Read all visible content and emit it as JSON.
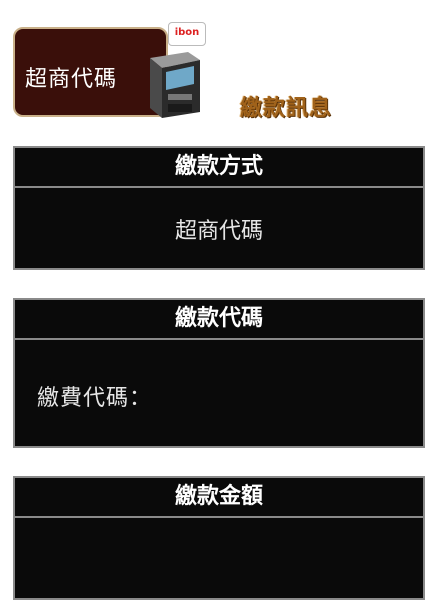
{
  "banner": {
    "label": "超商代碼",
    "badge": "ibon"
  },
  "info_title": "繳款訊息",
  "sections": [
    {
      "header": "繳款方式",
      "content": "超商代碼"
    },
    {
      "header": "繳款代碼",
      "content": "繳費代碼："
    },
    {
      "header": "繳款金額",
      "content": ""
    }
  ],
  "colors": {
    "banner_bg": "#3a0f0a",
    "panel_bg": "#0a0a0a",
    "title_accent": "#a0621a"
  }
}
